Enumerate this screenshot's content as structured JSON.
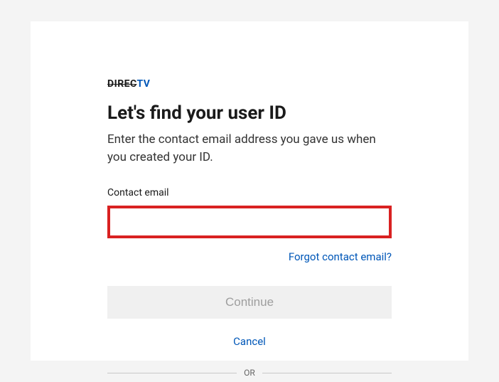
{
  "logo": {
    "part1": "DIREC",
    "part2": "TV"
  },
  "heading": "Let's find your user ID",
  "subheading": "Enter the contact email address you gave us when you created your ID.",
  "form": {
    "email_label": "Contact email",
    "email_value": "",
    "forgot_link": "Forgot contact email?",
    "continue_label": "Continue",
    "cancel_label": "Cancel"
  },
  "divider_text": "OR"
}
